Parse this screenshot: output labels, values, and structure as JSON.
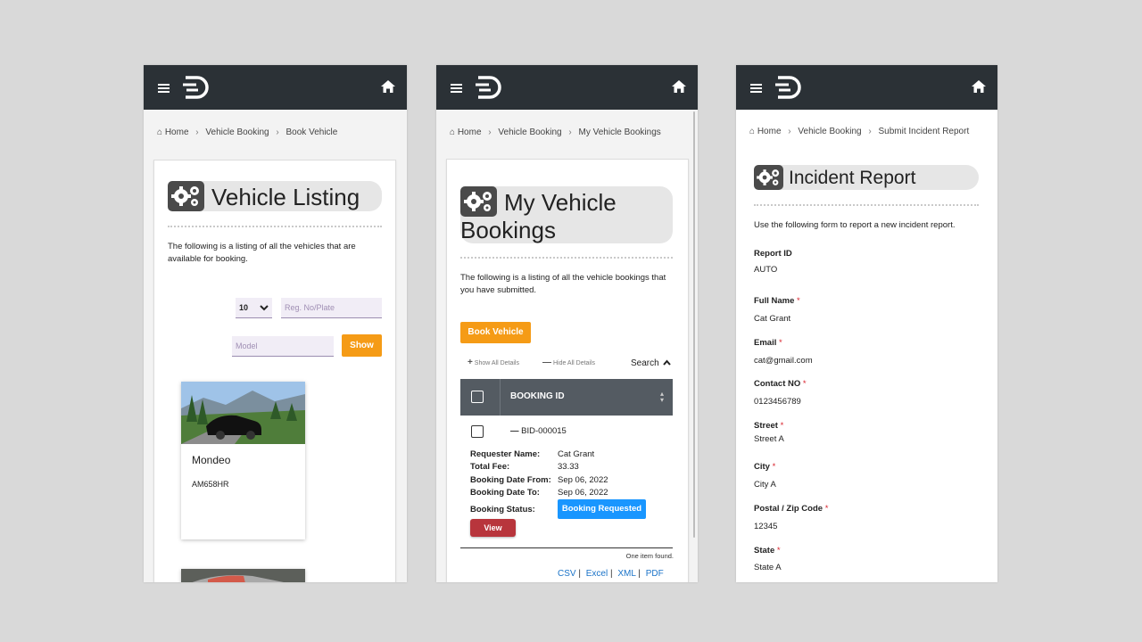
{
  "common": {
    "home_crumb": "Home",
    "vehicle_booking_crumb": "Vehicle Booking"
  },
  "colors": {
    "topbar": "#2b3136",
    "accent_orange": "#f59b16",
    "badge_blue": "#1996ff",
    "view_red": "#b8353c"
  },
  "screen1": {
    "crumb_current": "Book Vehicle",
    "title": "Vehicle Listing",
    "description": "The following is a listing of all the vehicles that are available for booking.",
    "page_size": "10",
    "reg_placeholder": "Reg. No/Plate",
    "model_placeholder": "Model",
    "show_label": "Show",
    "vehicles": [
      {
        "name": "Mondeo",
        "plate": "AM658HR"
      }
    ]
  },
  "screen2": {
    "crumb_current": "My Vehicle Bookings",
    "title_line1": "My Vehicle",
    "title_line2": "Bookings",
    "description": "The following is a listing of all the vehicle bookings that you have submitted.",
    "book_label": "Book Vehicle",
    "show_all": "Show All Details",
    "hide_all": "Hide All Details",
    "search": "Search",
    "column": "BOOKING ID",
    "row": {
      "id": "BID-000015",
      "requester_label": "Requester Name:",
      "requester": "Cat Grant",
      "fee_label": "Total Fee:",
      "fee": "33.33",
      "from_label": "Booking Date From:",
      "from": "Sep 06, 2022",
      "to_label": "Booking Date To:",
      "to": "Sep 06, 2022",
      "status_label": "Booking Status:",
      "status": "Booking Requested",
      "view": "View"
    },
    "found": "One item found.",
    "exports": [
      "CSV",
      "Excel",
      "XML",
      "PDF"
    ]
  },
  "screen3": {
    "crumb_current": "Submit Incident Report",
    "title": "Incident Report",
    "description": "Use the following form to report a new incident report.",
    "fields": [
      {
        "label": "Report ID",
        "required": false,
        "value": "AUTO"
      },
      {
        "label": "Full Name",
        "required": true,
        "value": "Cat Grant"
      },
      {
        "label": "Email",
        "required": true,
        "value": "cat@gmail.com"
      },
      {
        "label": "Contact NO",
        "required": true,
        "value": "0123456789"
      },
      {
        "label": "Street",
        "required": true,
        "value": "Street A"
      },
      {
        "label": "City",
        "required": true,
        "value": "City A"
      },
      {
        "label": "Postal / Zip Code",
        "required": true,
        "value": "12345"
      },
      {
        "label": "State",
        "required": true,
        "value": "State A"
      }
    ]
  }
}
